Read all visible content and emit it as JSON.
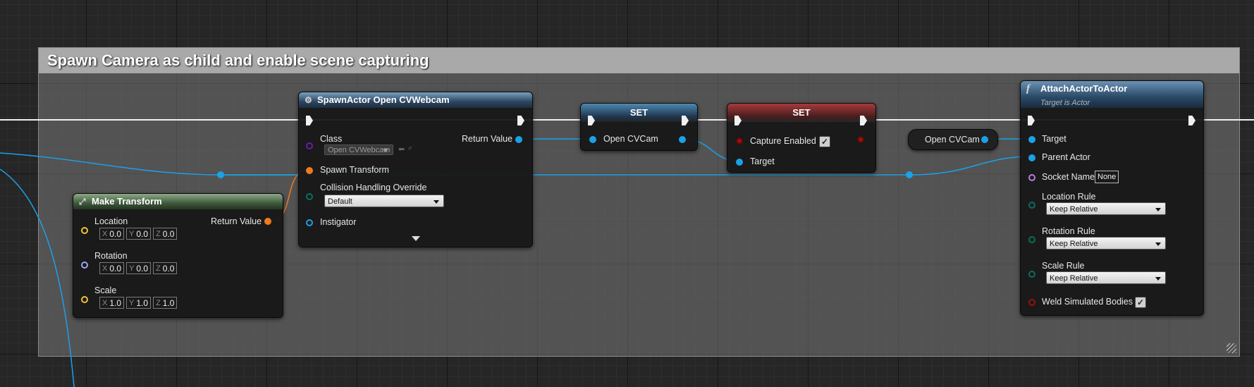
{
  "comment": {
    "title": "Spawn Camera as child and enable scene capturing"
  },
  "colors": {
    "object_pin": "#1ba1e8",
    "struct_pin": "#f07a1e",
    "transform_pin": "#f07a1e",
    "vector_pin": "#f1c232",
    "rotator_pin": "#9aa6f0",
    "class_pin": "#6a1ba8",
    "bool_pin": "#9b1010",
    "enum_pin": "#0a6e5e",
    "name_pin": "#b57be8",
    "exec": "#f0f0f0"
  },
  "make_transform": {
    "title": "Make Transform",
    "icon": "make-struct-icon",
    "location": {
      "label": "Location",
      "x": "0.0",
      "y": "0.0",
      "z": "0.0"
    },
    "rotation": {
      "label": "Rotation",
      "x": "0.0",
      "y": "0.0",
      "z": "0.0"
    },
    "scale": {
      "label": "Scale",
      "x": "1.0",
      "y": "1.0",
      "z": "1.0"
    },
    "return_label": "Return Value",
    "axis_x": "X",
    "axis_y": "Y",
    "axis_z": "Z"
  },
  "spawn_actor": {
    "title": "SpawnActor Open CVWebcam",
    "icon": "spawn-gear-icon",
    "class_label": "Class",
    "class_value": "Open CVWebcam",
    "return_label": "Return Value",
    "spawn_transform_label": "Spawn Transform",
    "collision_label": "Collision Handling Override",
    "collision_value": "Default",
    "instigator_label": "Instigator"
  },
  "set_1": {
    "title": "SET",
    "pin_label": "Open CVCam"
  },
  "set_2": {
    "title": "SET",
    "capture_label": "Capture Enabled",
    "capture_checked": "✓",
    "target_label": "Target"
  },
  "get_var": {
    "label": "Open CVCam"
  },
  "attach": {
    "title": "AttachActorToActor",
    "subtitle": "Target is Actor",
    "icon": "function-icon",
    "target_label": "Target",
    "parent_label": "Parent Actor",
    "socket_label": "Socket Name",
    "socket_value": "None",
    "location_rule_label": "Location Rule",
    "location_rule_value": "Keep Relative",
    "rotation_rule_label": "Rotation Rule",
    "rotation_rule_value": "Keep Relative",
    "scale_rule_label": "Scale Rule",
    "scale_rule_value": "Keep Relative",
    "weld_label": "Weld Simulated Bodies",
    "weld_checked": "✓"
  }
}
